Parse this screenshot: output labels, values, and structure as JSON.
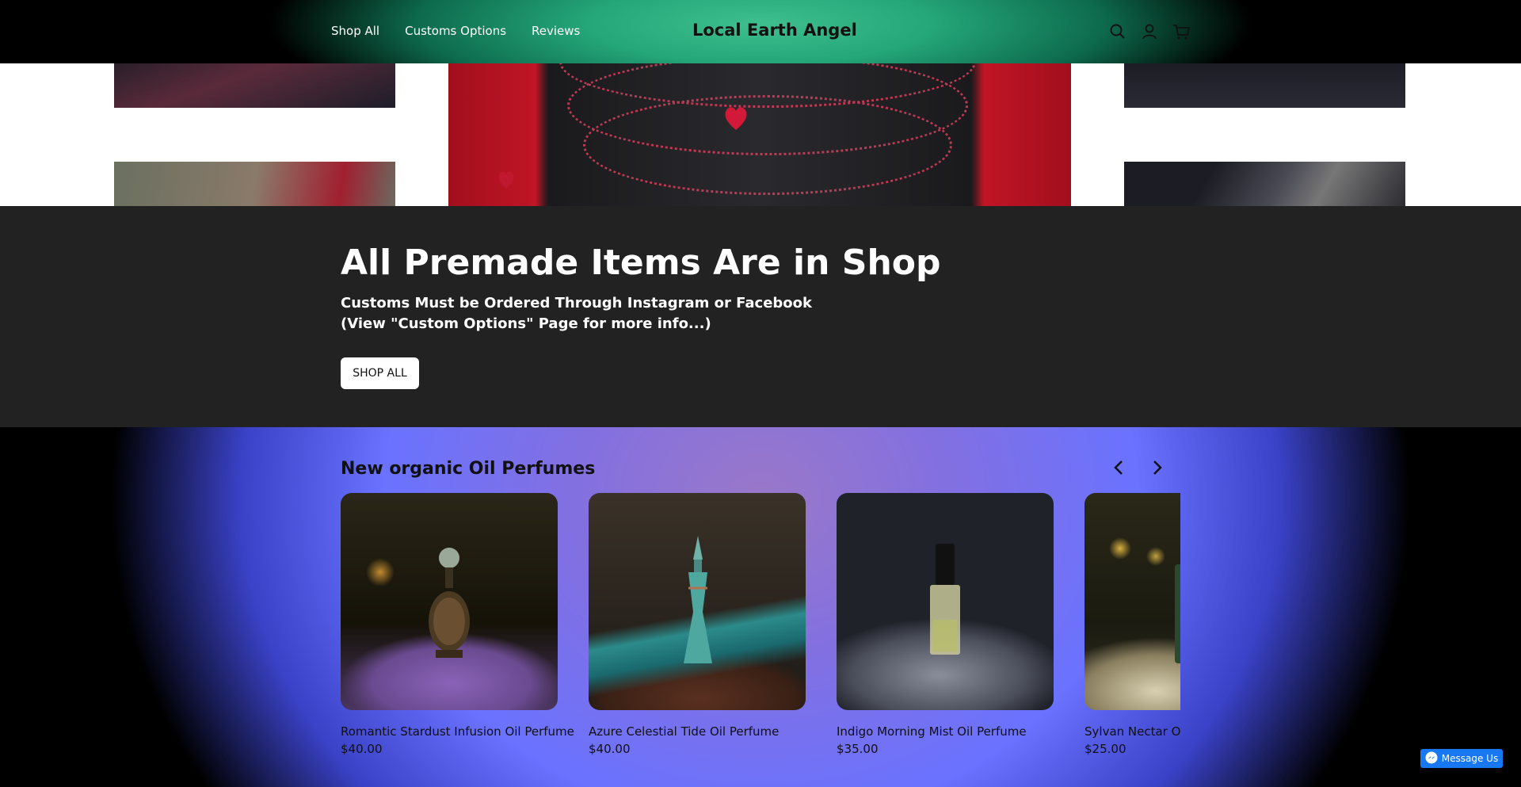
{
  "header": {
    "nav": [
      "Shop All",
      "Customs Options",
      "Reviews"
    ],
    "brand": "Local Earth Angel",
    "icons": [
      "search-icon",
      "account-icon",
      "cart-icon"
    ]
  },
  "banner": {
    "title": "All Premade Items Are in Shop",
    "subtitle_line1": "Customs Must be Ordered Through Instagram or Facebook",
    "subtitle_line2": "(View \"Custom Options\" Page for more info...)",
    "button": "SHOP ALL"
  },
  "collection": {
    "title": "New organic Oil Perfumes",
    "products": [
      {
        "name": "Romantic Stardust Infusion Oil Perfume",
        "price": "$40.00"
      },
      {
        "name": "Azure Celestial Tide Oil Perfume",
        "price": "$40.00"
      },
      {
        "name": "Indigo Morning Mist Oil Perfume",
        "price": "$35.00"
      },
      {
        "name": "Sylvan Nectar Oil Perfume",
        "price": "$25.00"
      }
    ]
  },
  "messenger": {
    "label": "Message Us"
  },
  "colors": {
    "header_accent": "#25a77a",
    "banner_bg": "#222222",
    "products_bg": "#6a72ff",
    "messenger": "#1877f2"
  }
}
